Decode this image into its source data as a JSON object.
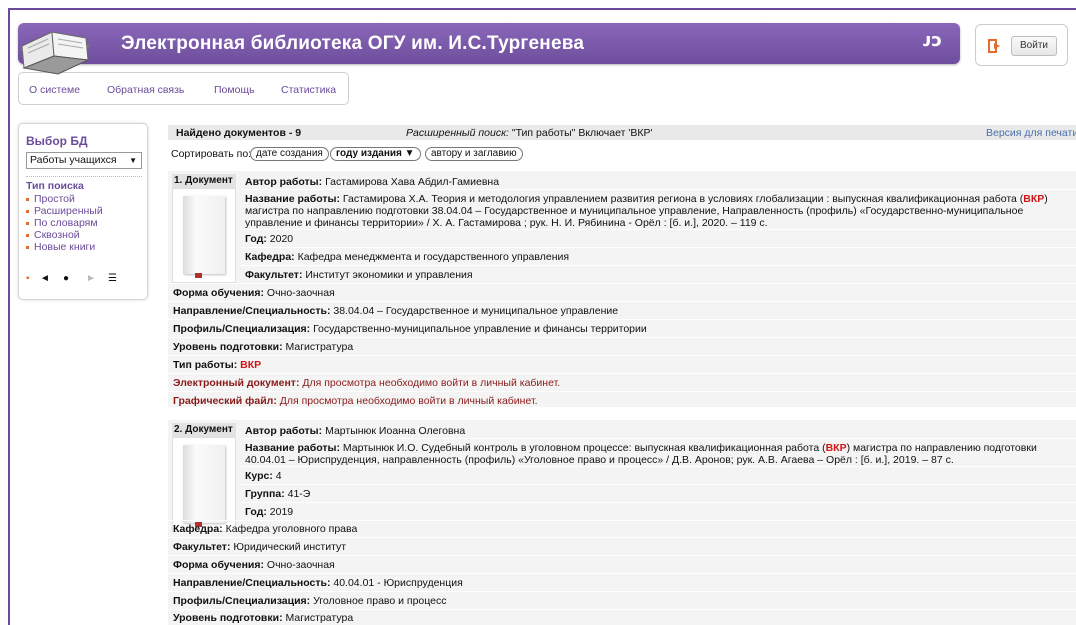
{
  "header": {
    "title": "Электронная библиотека ОГУ им. И.С.Тургенева",
    "logo_mark": "ᴊᴐ",
    "login_label": "Войти"
  },
  "nav": {
    "items": [
      "О системе",
      "Обратная связь",
      "Помощь",
      "Статистика"
    ]
  },
  "sidebar": {
    "db_heading": "Выбор БД",
    "db_value": "Работы учащихся",
    "search_heading": "Тип поиска",
    "search_types": [
      "Простой",
      "Расширенный",
      "По словарям",
      "Сквозной",
      "Новые книги"
    ],
    "controls": [
      "◄",
      "●",
      "►",
      "☰"
    ]
  },
  "results": {
    "found": "Найдено документов - 9",
    "query_prefix": "Расширенный поиск:",
    "query_text": " \"Тип работы\" Включает 'ВКР'",
    "print_link": "Версия для печати",
    "sort_label": "Сортировать по:",
    "sort_options": [
      "дате создания",
      "году издания ▼",
      "автору и заглавию"
    ]
  },
  "documents": [
    {
      "badge": "1. Документ",
      "author_label": "Автор работы:",
      "author": " Гастамирова Хава Абдил-Гамиевна",
      "title_label": "Название работы:",
      "title_a": " Гастамирова Х.А. Теория и методология управлением развития региона в условиях глобализации : выпускная квалификационная работа (",
      "title_hl": "ВКР",
      "title_b": ") магистра по направлению подготовки 38.04.04 – Государственное и муниципальное управление, Направленность (профиль) «Государственно-муниципальное управление и финансы территории» / Х. А. Гастамирова ; рук. Н. И. Рябинина - Орёл : [б. и.], 2020. – 119 с.",
      "year_label": "Год:",
      "year": " 2020",
      "dept_label": "Кафедра:",
      "dept": " Кафедра менеджмента и государственного управления",
      "faculty_label": "Факультет:",
      "faculty": " Институт экономики и управления",
      "form_label": "Форма обучения:",
      "form": " Очно-заочная",
      "spec_label": "Направление/Специальность:",
      "spec": " 38.04.04 – Государственное и муниципальное управление",
      "profile_label": "Профиль/Специализация:",
      "profile": " Государственно-муниципальное управление и финансы территории",
      "level_label": "Уровень подготовки:",
      "level": " Магистратура",
      "type_label": "Тип работы:",
      "type": " ВКР",
      "edoc_label": "Электронный документ:",
      "edoc": " Для просмотра необходимо войти в личный кабинет.",
      "gfile_label": "Графический файл:",
      "gfile": " Для просмотра необходимо войти в личный кабинет."
    },
    {
      "badge": "2. Документ",
      "author_label": "Автор работы:",
      "author": " Мартынюк Иоанна Олеговна",
      "title_label": "Название работы:",
      "title_a": " Мартынюк И.О. Судебный контроль в уголовном процессе: выпускная квалификационная работа (",
      "title_hl": "ВКР",
      "title_b": ") магистра по направлению подготовки 40.04.01 – Юриспруденция, направленность (профиль) «Уголовное право и процесс» / Д.В. Аронов; рук. А.В. Агаева – Орёл : [б. и.], 2019. – 87 с.",
      "course_label": "Курс:",
      "course": " 4",
      "group_label": "Группа:",
      "group": " 41-Э",
      "year_label": "Год:",
      "year": " 2019",
      "dept_label": "Кафедра:",
      "dept": " Кафедра уголовного права",
      "faculty_label": "Факультет:",
      "faculty": " Юридический институт",
      "form_label": "Форма обучения:",
      "form": " Очно-заочная",
      "spec_label": "Направление/Специальность:",
      "spec": " 40.04.01 - Юриспруденция",
      "profile_label": "Профиль/Специализация:",
      "profile": " Уголовное право и процесс",
      "level_label": "Уровень подготовки:",
      "level": " Магистратура"
    }
  ]
}
